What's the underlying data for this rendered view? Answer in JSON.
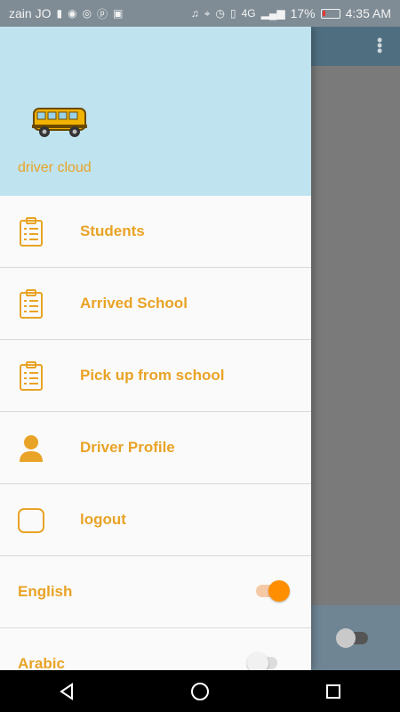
{
  "status_bar": {
    "carrier": "zain JO",
    "network": "4G",
    "battery": "17%",
    "time": "4:35 AM"
  },
  "drawer": {
    "brand": "driver cloud",
    "items": [
      {
        "label": "Students",
        "icon": "clipboard-icon"
      },
      {
        "label": "Arrived School",
        "icon": "clipboard-icon"
      },
      {
        "label": "Pick up from school",
        "icon": "clipboard-icon"
      },
      {
        "label": "Driver Profile",
        "icon": "person-icon"
      },
      {
        "label": "logout",
        "icon": "logout-icon"
      }
    ],
    "languages": [
      {
        "label": "English",
        "selected": true
      },
      {
        "label": "Arabic",
        "selected": false
      }
    ]
  },
  "colors": {
    "accent": "#e9a326",
    "toggle_on": "#ff8f00",
    "header_bg": "#bfe3ef"
  }
}
